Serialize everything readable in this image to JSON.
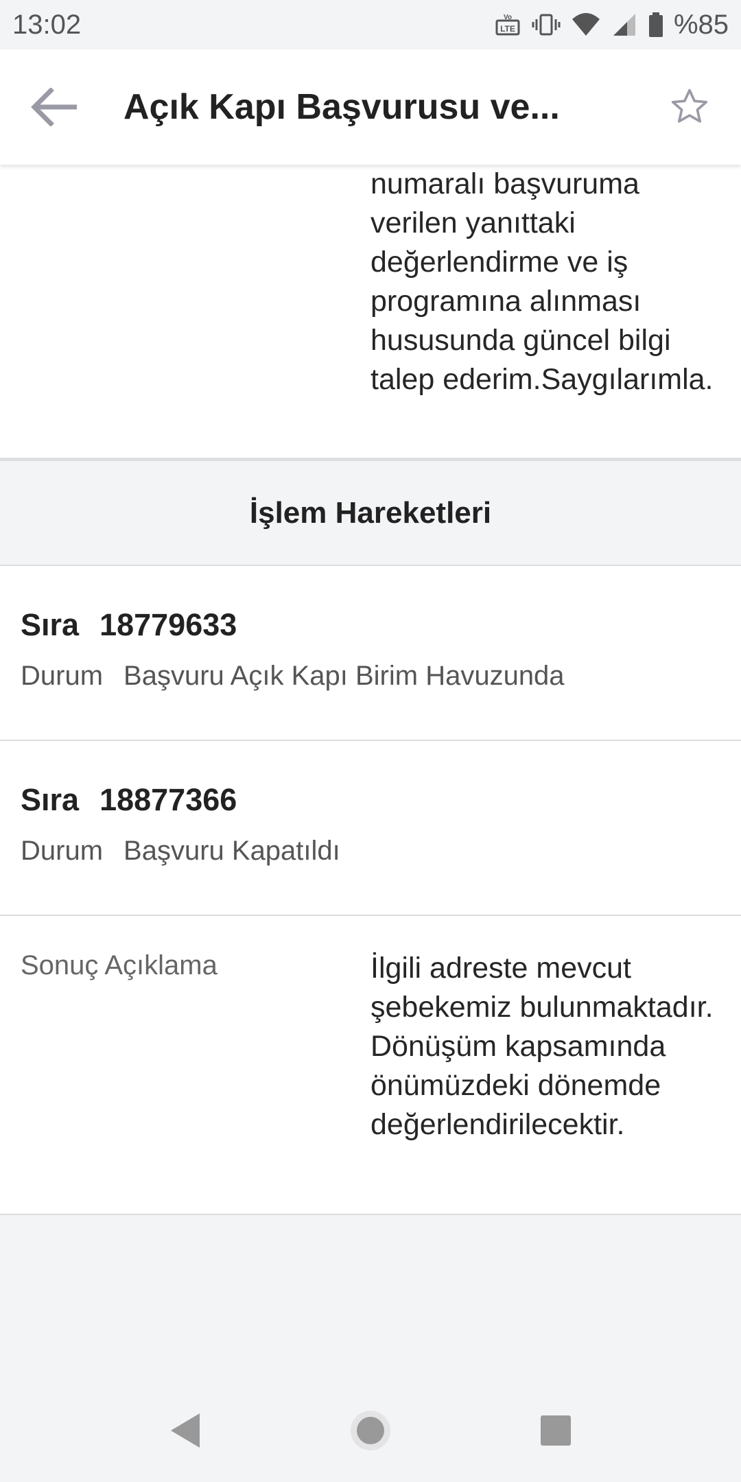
{
  "status_bar": {
    "time": "13:02",
    "battery": "%85",
    "icons": [
      "volte-lte-icon",
      "vibrate-icon",
      "wifi-icon",
      "signal-icon",
      "battery-icon"
    ]
  },
  "app_bar": {
    "title": "Açık Kapı Başvurusu ve...",
    "back_icon": "arrow-back-icon",
    "favorite_icon": "star-outline-icon"
  },
  "description": {
    "text": "numaralı başvuruma verilen yanıttaki değerlendirme ve iş programına alınması hususunda güncel bilgi talep ederim.Saygılarımla."
  },
  "movements": {
    "header": "İşlem Hareketleri",
    "sira_label": "Sıra",
    "durum_label": "Durum",
    "items": [
      {
        "sira": "18779633",
        "durum": "Başvuru Açık Kapı Birim Havuzunda"
      },
      {
        "sira": "18877366",
        "durum": "Başvuru Kapatıldı"
      }
    ]
  },
  "result": {
    "label": "Sonuç Açıklama",
    "text": "İlgili adreste mevcut şebekemiz bulunmaktadır. Dönüşüm kapsamında önümüzdeki dönemde değerlendirilecektir."
  },
  "colors": {
    "background": "#f3f4f6",
    "surface": "#ffffff",
    "divider": "#dcdcdc",
    "icon": "#9a9aa6"
  }
}
